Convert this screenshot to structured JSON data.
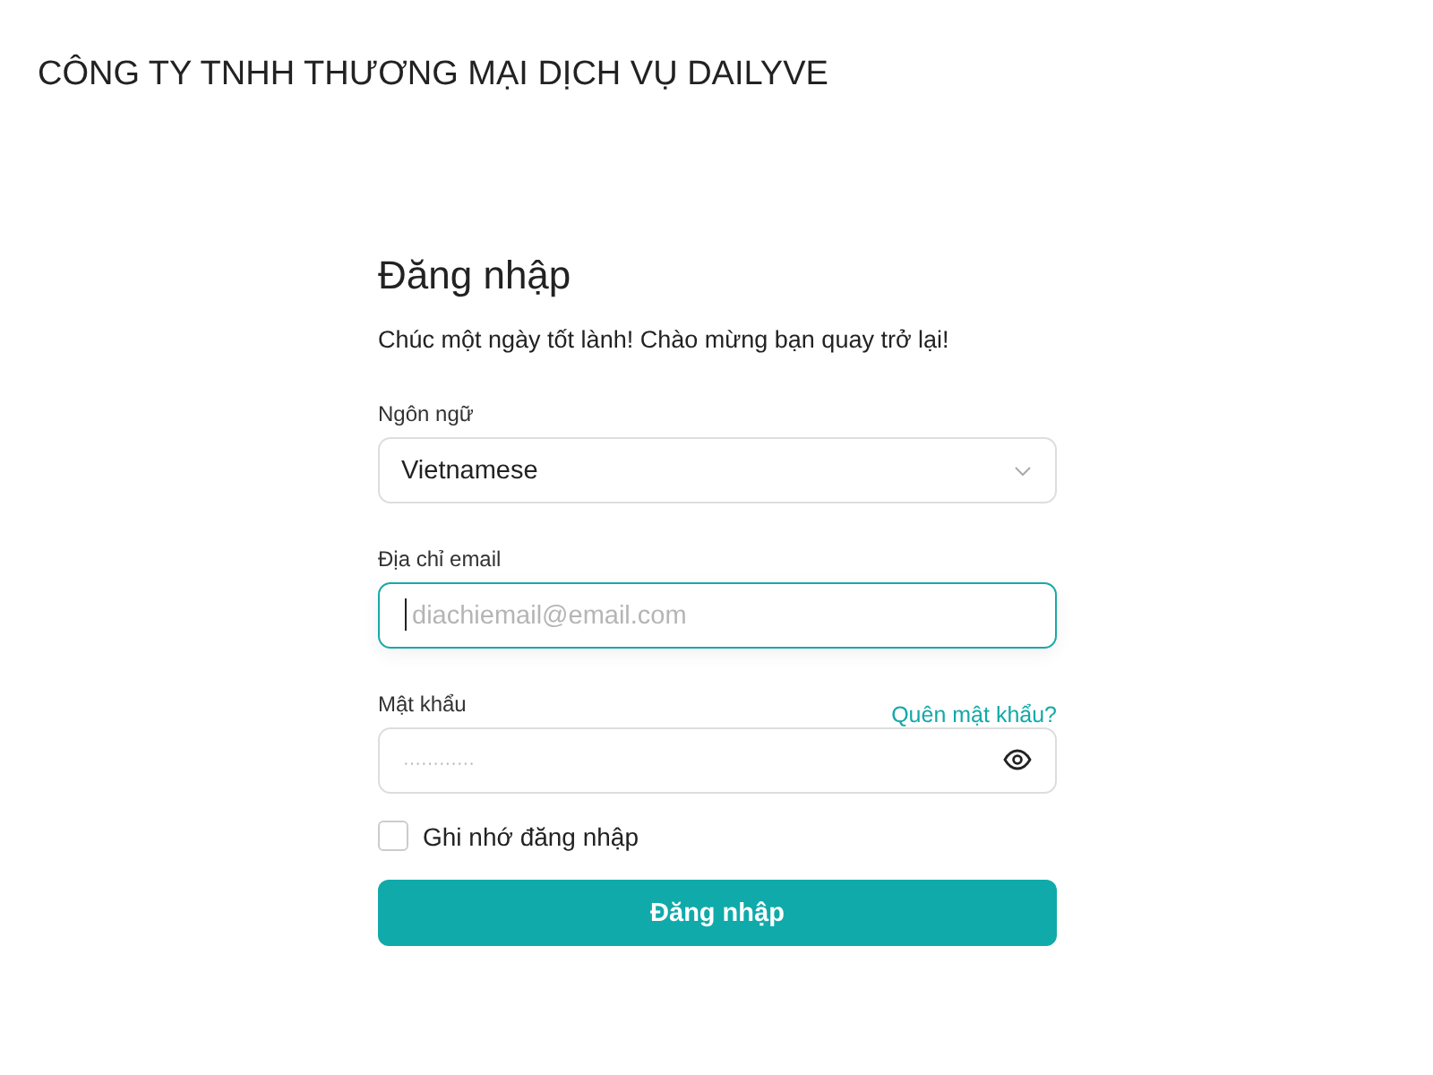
{
  "company": "CÔNG TY TNHH THƯƠNG MẠI DỊCH VỤ DAILYVE",
  "form": {
    "title": "Đăng nhập",
    "subtitle": "Chúc một ngày tốt lành! Chào mừng bạn quay trở lại!",
    "language": {
      "label": "Ngôn ngữ",
      "value": "Vietnamese"
    },
    "email": {
      "label": "Địa chỉ email",
      "placeholder": "diachiemail@email.com",
      "focused": true
    },
    "password": {
      "label": "Mật khẩu",
      "placeholder": "············",
      "forgot_link": "Quên mật khẩu?",
      "focused": false
    },
    "remember": {
      "label": "Ghi nhớ đăng nhập",
      "checked": false
    },
    "submit": "Đăng nhập"
  }
}
